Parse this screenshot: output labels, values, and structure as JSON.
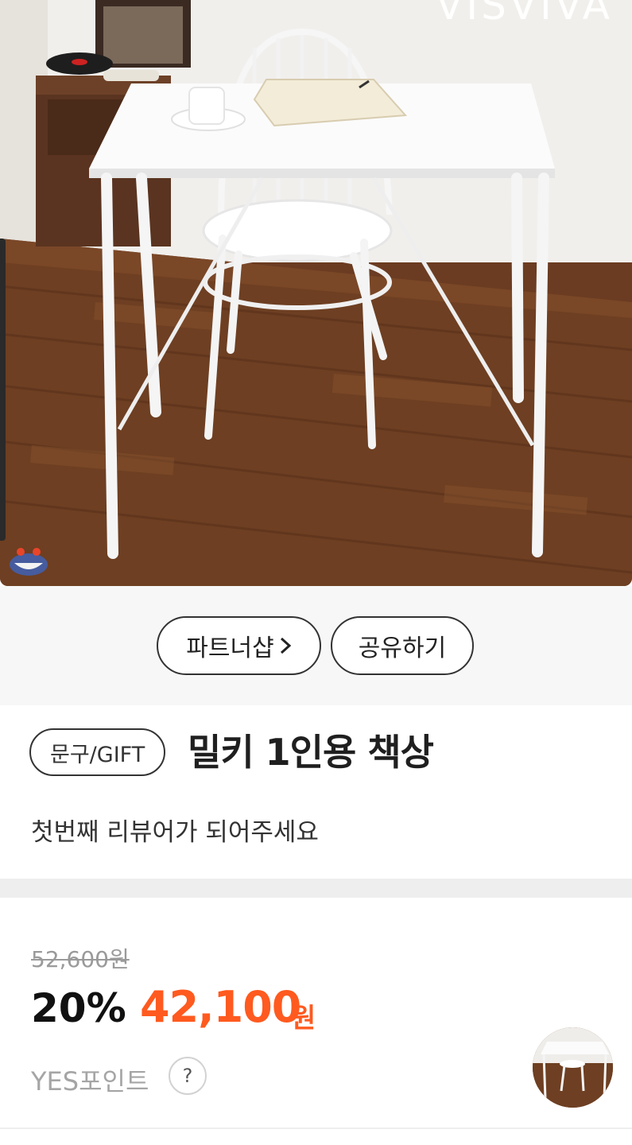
{
  "hero": {
    "brand_mark": "VISVIVA",
    "image_subject": "white-desk-and-chair-photo"
  },
  "actions": {
    "partner_shop_label": "파트너샵",
    "share_label": "공유하기"
  },
  "product": {
    "category": "문구/GIFT",
    "title": "밀키 1인용 책상",
    "review_cta": "첫번째 리뷰어가 되어주세요"
  },
  "price": {
    "original": "52,600원",
    "discount_rate": "20%",
    "sale": "42,100",
    "currency": "원",
    "points_label": "YES포인트",
    "help": "?"
  },
  "colors": {
    "accent": "#ff5a1f",
    "text_dark": "#222222",
    "muted": "#9a9a9a",
    "strip_bg": "#f7f7f7"
  }
}
